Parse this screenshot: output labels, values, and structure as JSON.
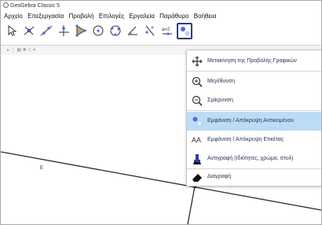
{
  "window": {
    "title": "GeoGebra Classic 5"
  },
  "menu": [
    "Αρχείο",
    "Επεξεργασία",
    "Προβολή",
    "Επιλογές",
    "Εργαλεία",
    "Παράθυρο",
    "Βοήθεια"
  ],
  "toolbar": {
    "tools": [
      {
        "icon": "move-arrow-icon"
      },
      {
        "icon": "point-on-line-icon"
      },
      {
        "icon": "line-icon"
      },
      {
        "icon": "perpendicular-line-icon"
      },
      {
        "icon": "polygon-icon"
      },
      {
        "icon": "circle-center-icon"
      },
      {
        "icon": "conic-icon"
      },
      {
        "icon": "angle-icon"
      },
      {
        "icon": "reflect-icon"
      },
      {
        "icon": "slider-icon",
        "text": "a=2"
      },
      {
        "icon": "show-hide-object-icon",
        "active": true
      }
    ]
  },
  "dropdown": {
    "items": [
      {
        "label": "Μετακίνηση της Προβολής Γραφικών",
        "icon": "move-view-icon",
        "highlighted": false
      },
      {
        "label": "Μεγέθυνση",
        "icon": "zoom-in-icon",
        "highlighted": false
      },
      {
        "label": "Σμίκρυνση",
        "icon": "zoom-out-icon",
        "highlighted": false
      },
      {
        "label": "Εμφάνιση / Απόκρυψη Αντικειμένου",
        "icon": "show-hide-object-icon",
        "highlighted": true
      },
      {
        "label": "Εμφάνιση / Απόκρυψη Ετικέτας",
        "icon": "label-icon",
        "icon_text": "AA",
        "highlighted": false
      },
      {
        "label": "Αντιγραφή (Ιδιότητες, χρώμα, στυλ)",
        "icon": "copy-style-icon",
        "highlighted": false
      },
      {
        "label": "Διαγραφή",
        "icon": "eraser-icon",
        "highlighted": false
      }
    ]
  },
  "canvas": {
    "point_label": "E"
  },
  "colors": {
    "highlight": "#bcdcf6",
    "active_border": "#2c3e7a",
    "label_text": "#2b3350"
  }
}
